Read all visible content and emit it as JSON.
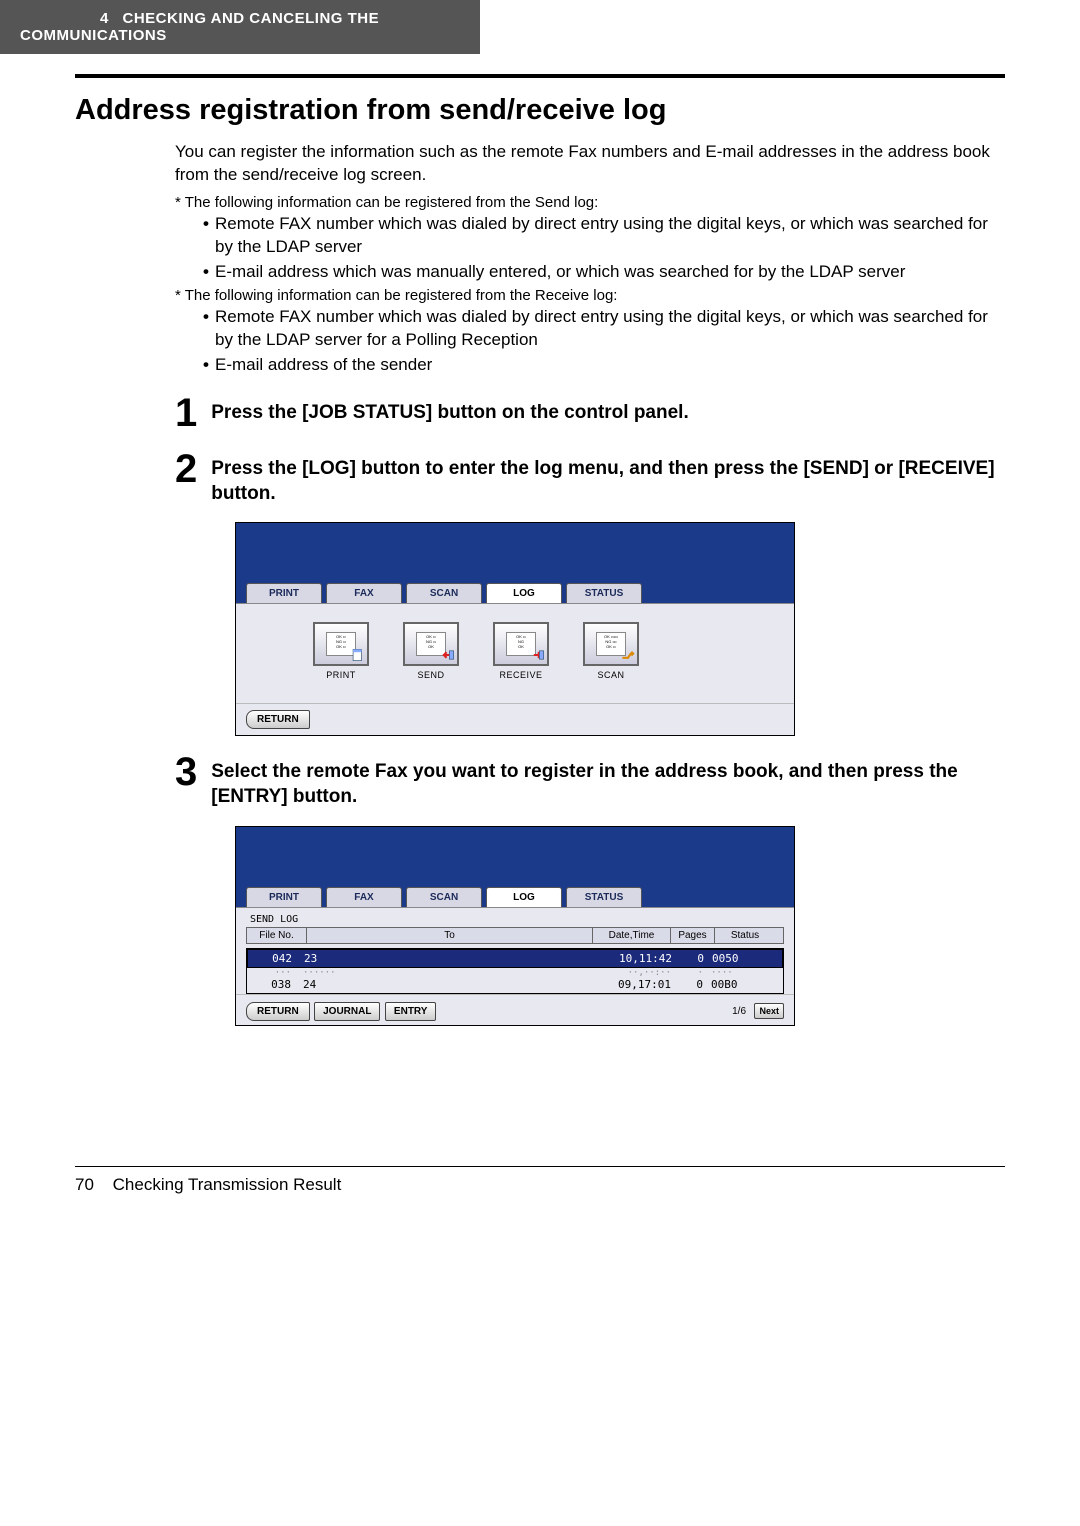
{
  "header": {
    "chapter_num": "4",
    "chapter_title": "CHECKING AND CANCELING THE COMMUNICATIONS"
  },
  "title": "Address registration from send/receive log",
  "intro": "You can register the information such as the remote Fax numbers and E-mail addresses in the address book from the send/receive log screen.",
  "notes": {
    "send_intro": "The following information can be registered from the Send log:",
    "send_bullets": [
      "Remote FAX number which was dialed by direct entry using the digital keys, or which was searched for by the LDAP server",
      "E-mail address which was manually entered, or which was searched for by the LDAP server"
    ],
    "recv_intro": "The following information can be registered from the Receive log:",
    "recv_bullets": [
      "Remote FAX number which was dialed by direct entry using the digital keys, or which was searched for by the LDAP server for a Polling Reception",
      "E-mail address of the sender"
    ]
  },
  "steps": {
    "s1": {
      "num": "1",
      "text": "Press the [JOB STATUS] button on the control panel."
    },
    "s2": {
      "num": "2",
      "text": "Press the [LOG] button to enter the log menu, and then press the [SEND] or [RECEIVE] button."
    },
    "s3": {
      "num": "3",
      "text": "Select the remote Fax you want to register in the address book, and then press the [ENTRY] button."
    }
  },
  "screen1": {
    "tabs": {
      "print": "PRINT",
      "fax": "FAX",
      "scan": "SCAN",
      "log": "LOG",
      "status": "STATUS"
    },
    "icons": {
      "print": "PRINT",
      "send": "SEND",
      "receive": "RECEIVE",
      "scan": "SCAN"
    },
    "return_btn": "RETURN"
  },
  "screen2": {
    "tabs": {
      "print": "PRINT",
      "fax": "FAX",
      "scan": "SCAN",
      "log": "LOG",
      "status": "STATUS"
    },
    "send_log_label": "SEND LOG",
    "columns": {
      "fileno": "File No.",
      "to": "To",
      "datetime": "Date,Time",
      "pages": "Pages",
      "status": "Status"
    },
    "rows": [
      {
        "fileno": "042",
        "to": "23",
        "datetime": "10,11:42",
        "pages": "0",
        "status": "0050"
      },
      {
        "fileno": "038",
        "to": "24",
        "datetime": "09,17:01",
        "pages": "0",
        "status": "00B0"
      }
    ],
    "buttons": {
      "return": "RETURN",
      "journal": "JOURNAL",
      "entry": "ENTRY",
      "next": "Next"
    },
    "pager": "1/6"
  },
  "footer": {
    "page_num": "70",
    "section": "Checking Transmission Result"
  }
}
